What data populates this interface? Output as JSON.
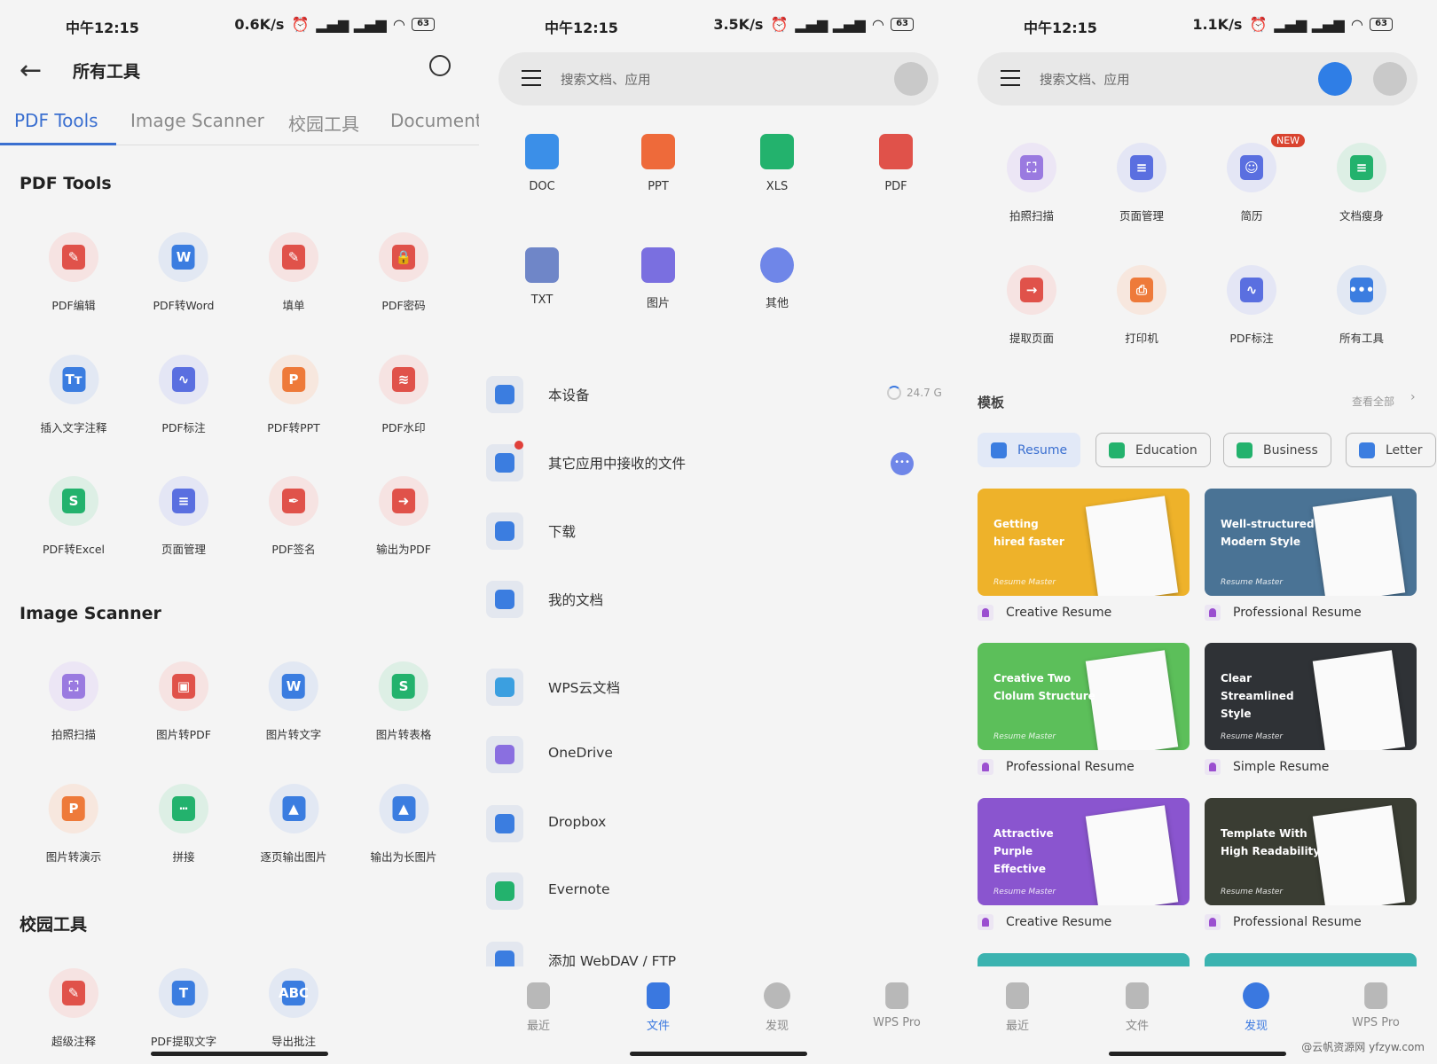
{
  "status_bars": [
    {
      "time": "中午12:15",
      "speed": "0.6K/s",
      "battery": "63"
    },
    {
      "time": "中午12:15",
      "speed": "3.5K/s",
      "battery": "63"
    },
    {
      "time": "中午12:15",
      "speed": "1.1K/s",
      "battery": "63"
    }
  ],
  "all_tools": {
    "title": "所有工具",
    "tabs": [
      {
        "label": "PDF Tools",
        "active": true
      },
      {
        "label": "Image Scanner"
      },
      {
        "label": "校园工具"
      },
      {
        "label": "Document"
      }
    ],
    "sections": [
      {
        "heading": "PDF Tools",
        "items": [
          {
            "label": "PDF编辑",
            "icon": "pdf-edit-icon",
            "color": "#e0524a",
            "bg": "#f6e3e2",
            "glyph": "✎"
          },
          {
            "label": "PDF转Word",
            "icon": "pdf-to-word-icon",
            "color": "#3b7de0",
            "bg": "#e2e8f3",
            "glyph": "W"
          },
          {
            "label": "填单",
            "icon": "fill-form-icon",
            "color": "#e0524a",
            "bg": "#f6e3e2",
            "glyph": "✎"
          },
          {
            "label": "PDF密码",
            "icon": "lock-icon",
            "color": "#e0524a",
            "bg": "#f6e3e2",
            "glyph": "🔒"
          },
          {
            "label": "插入文字注释",
            "icon": "text-annotation-icon",
            "color": "#3b7de0",
            "bg": "#e2e8f3",
            "glyph": "Tт"
          },
          {
            "label": "PDF标注",
            "icon": "pdf-markup-icon",
            "color": "#5a6fe0",
            "bg": "#e4e6f5",
            "glyph": "∿"
          },
          {
            "label": "PDF转PPT",
            "icon": "pdf-to-ppt-icon",
            "color": "#ee7a3a",
            "bg": "#f7e7de",
            "glyph": "P"
          },
          {
            "label": "PDF水印",
            "icon": "watermark-icon",
            "color": "#e0524a",
            "bg": "#f6e3e2",
            "glyph": "≋"
          },
          {
            "label": "PDF转Excel",
            "icon": "pdf-to-excel-icon",
            "color": "#23b26d",
            "bg": "#ddefe5",
            "glyph": "S"
          },
          {
            "label": "页面管理",
            "icon": "page-manage-icon",
            "color": "#5a6fe0",
            "bg": "#e4e6f5",
            "glyph": "≡"
          },
          {
            "label": "PDF签名",
            "icon": "signature-icon",
            "color": "#e0524a",
            "bg": "#f6e3e2",
            "glyph": "✒"
          },
          {
            "label": "输出为PDF",
            "icon": "export-pdf-icon",
            "color": "#e0524a",
            "bg": "#f6e3e2",
            "glyph": "➜"
          }
        ]
      },
      {
        "heading": "Image Scanner",
        "items": [
          {
            "label": "拍照扫描",
            "icon": "scan-icon",
            "color": "#9a7ae0",
            "bg": "#ece6f5",
            "glyph": "⛶"
          },
          {
            "label": "图片转PDF",
            "icon": "image-to-pdf-icon",
            "color": "#e0524a",
            "bg": "#f6e3e2",
            "glyph": "▣"
          },
          {
            "label": "图片转文字",
            "icon": "image-to-text-icon",
            "color": "#3b7de0",
            "bg": "#e2e8f3",
            "glyph": "W"
          },
          {
            "label": "图片转表格",
            "icon": "image-to-table-icon",
            "color": "#23b26d",
            "bg": "#ddefe5",
            "glyph": "S"
          },
          {
            "label": "图片转演示",
            "icon": "image-to-ppt-icon",
            "color": "#ee7a3a",
            "bg": "#f7e7de",
            "glyph": "P"
          },
          {
            "label": "拼接",
            "icon": "stitch-icon",
            "color": "#23b26d",
            "bg": "#ddefe5",
            "glyph": "┅"
          },
          {
            "label": "逐页输出图片",
            "icon": "export-images-icon",
            "color": "#3b7de0",
            "bg": "#e2e8f3",
            "glyph": "▲"
          },
          {
            "label": "输出为长图片",
            "icon": "long-image-icon",
            "color": "#3b7de0",
            "bg": "#e2e8f3",
            "glyph": "▲"
          }
        ]
      },
      {
        "heading": "校园工具",
        "items": [
          {
            "label": "超级注释",
            "icon": "super-annotation-icon",
            "color": "#e0524a",
            "bg": "#f6e3e2",
            "glyph": "✎"
          },
          {
            "label": "PDF提取文字",
            "icon": "extract-text-icon",
            "color": "#3b7de0",
            "bg": "#e2e8f3",
            "glyph": "T"
          },
          {
            "label": "导出批注",
            "icon": "export-annotations-icon",
            "color": "#3b7de0",
            "bg": "#e2e8f3",
            "glyph": "ABC"
          }
        ]
      }
    ]
  },
  "files": {
    "search_placeholder": "搜索文档、应用",
    "types": [
      {
        "label": "DOC",
        "color": "#3b8fe8"
      },
      {
        "label": "PPT",
        "color": "#ee6a3a"
      },
      {
        "label": "XLS",
        "color": "#23b26d"
      },
      {
        "label": "PDF",
        "color": "#e0524a"
      },
      {
        "label": "TXT",
        "color": "#6f86c8"
      },
      {
        "label": "图片",
        "color": "#7a6fe0"
      },
      {
        "label": "其他",
        "color": "#6f86e8"
      }
    ],
    "locations": [
      {
        "label": "本设备",
        "color": "#3b7de0",
        "meta": "24.7 G"
      },
      {
        "label": "其它应用中接收的文件",
        "color": "#3b7de0",
        "badge": true
      },
      {
        "label": "下载",
        "color": "#3b7de0"
      },
      {
        "label": "我的文档",
        "color": "#3b7de0"
      },
      {
        "label": "WPS云文档",
        "color": "#3b9fe0"
      },
      {
        "label": "OneDrive",
        "color": "#8a6fe0"
      },
      {
        "label": "Dropbox",
        "color": "#3b7de0"
      },
      {
        "label": "Evernote",
        "color": "#23b26d"
      },
      {
        "label": "添加 WebDAV / FTP",
        "color": "#3b7de0"
      }
    ]
  },
  "discover": {
    "search_placeholder": "搜索文档、应用",
    "tools": [
      {
        "label": "拍照扫描",
        "icon": "scan-icon",
        "color": "#9a7ae0",
        "bg": "#ece6f5",
        "glyph": "⛶"
      },
      {
        "label": "页面管理",
        "icon": "page-manage-icon",
        "color": "#5a6fe0",
        "bg": "#e4e6f5",
        "glyph": "≡"
      },
      {
        "label": "简历",
        "icon": "resume-icon",
        "color": "#5a6fe0",
        "bg": "#e4e6f5",
        "glyph": "☺",
        "badge": "NEW"
      },
      {
        "label": "文档瘦身",
        "icon": "compress-icon",
        "color": "#23b26d",
        "bg": "#ddefe5",
        "glyph": "≡"
      },
      {
        "label": "提取页面",
        "icon": "extract-page-icon",
        "color": "#e0524a",
        "bg": "#f6e3e2",
        "glyph": "→"
      },
      {
        "label": "打印机",
        "icon": "printer-icon",
        "color": "#ee7a3a",
        "bg": "#f7e7de",
        "glyph": "⎙"
      },
      {
        "label": "PDF标注",
        "icon": "pdf-markup-icon",
        "color": "#5a6fe0",
        "bg": "#e4e6f5",
        "glyph": "∿"
      },
      {
        "label": "所有工具",
        "icon": "more-icon",
        "color": "#3b7de0",
        "bg": "#e2e8f3",
        "glyph": "•••"
      }
    ],
    "templates_heading": "模板",
    "view_all": "查看全部",
    "chips": [
      {
        "label": "Resume",
        "color": "#3b7de0",
        "active": true
      },
      {
        "label": "Education",
        "color": "#23b26d"
      },
      {
        "label": "Business",
        "color": "#23b26d"
      },
      {
        "label": "Letter",
        "color": "#3b7de0"
      }
    ],
    "cards": [
      {
        "title": "Getting\nhired faster",
        "brand": "Resume Master",
        "caption": "Creative Resume",
        "bg": "#eeb22a"
      },
      {
        "title": "Well-structured\nModern Style",
        "brand": "Resume Master",
        "caption": "Professional Resume",
        "bg": "#4a7395"
      },
      {
        "title": "Creative Two\nClolum Structure",
        "brand": "Resume Master",
        "caption": "Professional Resume",
        "bg": "#5cbf5a"
      },
      {
        "title": "Clear\nStreamlined\nStyle",
        "brand": "Resume Master",
        "caption": "Simple Resume",
        "bg": "#2f3236"
      },
      {
        "title": "Attractive\nPurple\nEffective",
        "brand": "Resume Master",
        "caption": "Creative Resume",
        "bg": "#8a55cf"
      },
      {
        "title": "Template With\nHigh Readability",
        "brand": "Resume Master",
        "caption": "Professional Resume",
        "bg": "#3a3d33"
      }
    ]
  },
  "bottom_nav": {
    "items": [
      {
        "label": "最近"
      },
      {
        "label": "文件"
      },
      {
        "label": "发现"
      },
      {
        "label": "WPS Pro"
      }
    ],
    "files_active": 1,
    "discover_active": 2
  },
  "watermark": "@云帆资源网 yfzyw.com"
}
